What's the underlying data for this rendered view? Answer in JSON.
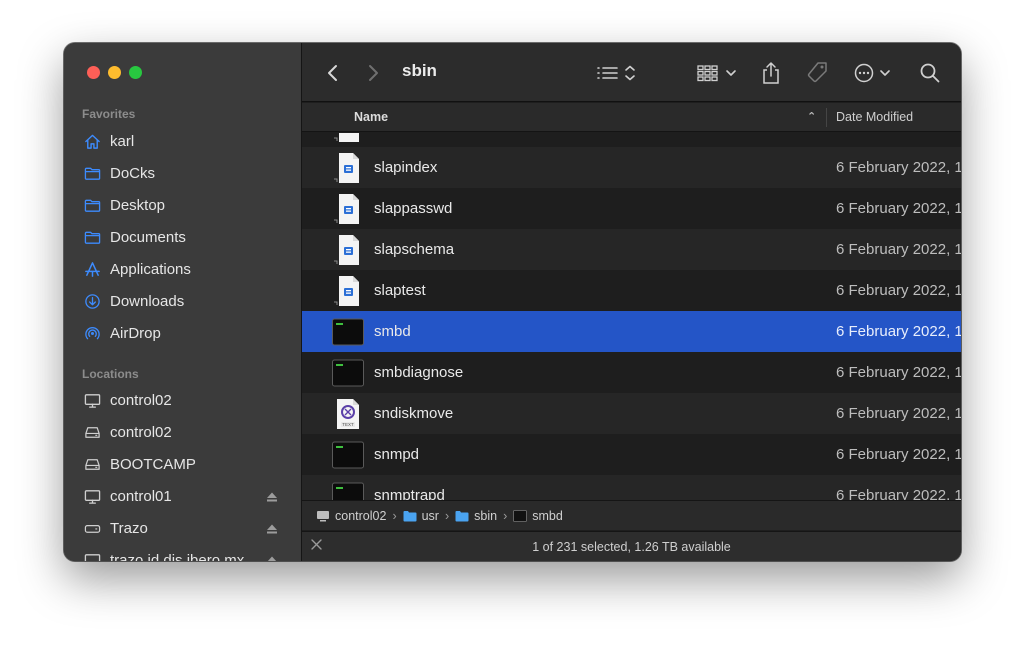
{
  "sidebar": {
    "favorites_title": "Favorites",
    "favorites": [
      {
        "label": "karl",
        "icon": "home-icon"
      },
      {
        "label": "DoCks",
        "icon": "folder-icon"
      },
      {
        "label": "Desktop",
        "icon": "folder-icon"
      },
      {
        "label": "Documents",
        "icon": "folder-icon"
      },
      {
        "label": "Applications",
        "icon": "applications-icon"
      },
      {
        "label": "Downloads",
        "icon": "downloads-icon"
      },
      {
        "label": "AirDrop",
        "icon": "airdrop-icon"
      }
    ],
    "locations_title": "Locations",
    "locations": [
      {
        "label": "control02",
        "icon": "computer-icon"
      },
      {
        "label": "control02",
        "icon": "drive-icon"
      },
      {
        "label": "BOOTCAMP",
        "icon": "drive-icon"
      },
      {
        "label": "control01",
        "icon": "computer-icon",
        "eject": true
      },
      {
        "label": "Trazo",
        "icon": "external-drive-icon",
        "eject": true
      },
      {
        "label": "trazo.id.dis.ibero.mx",
        "icon": "computer-icon",
        "eject": true
      }
    ]
  },
  "toolbar": {
    "title": "sbin"
  },
  "columns": {
    "name": "Name",
    "date_modified": "Date Modified"
  },
  "files": [
    {
      "name": "",
      "type": "document",
      "date": ""
    },
    {
      "name": "slapindex",
      "type": "document",
      "date": "6 February 2022, 1"
    },
    {
      "name": "slappasswd",
      "type": "document",
      "date": "6 February 2022, 1"
    },
    {
      "name": "slapschema",
      "type": "document",
      "date": "6 February 2022, 1"
    },
    {
      "name": "slaptest",
      "type": "document",
      "date": "6 February 2022, 1"
    },
    {
      "name": "smbd",
      "type": "exec",
      "date": "6 February 2022, 1",
      "selected": true
    },
    {
      "name": "smbdiagnose",
      "type": "exec",
      "date": "6 February 2022, 1"
    },
    {
      "name": "sndiskmove",
      "type": "text",
      "date": "6 February 2022, 1"
    },
    {
      "name": "snmpd",
      "type": "exec",
      "date": "6 February 2022, 1"
    },
    {
      "name": "snmptrapd",
      "type": "exec",
      "date": "6 February 2022, 1"
    }
  ],
  "pathbar": [
    {
      "label": "control02",
      "icon": "computer-icon"
    },
    {
      "label": "usr",
      "icon": "folder-icon"
    },
    {
      "label": "sbin",
      "icon": "folder-icon"
    },
    {
      "label": "smbd",
      "icon": "exec-icon"
    }
  ],
  "status": {
    "text": "1 of 231 selected, 1.26 TB available"
  },
  "colors": {
    "selection": "#2455c7",
    "sidebar_icon": "#3d8bfd"
  }
}
